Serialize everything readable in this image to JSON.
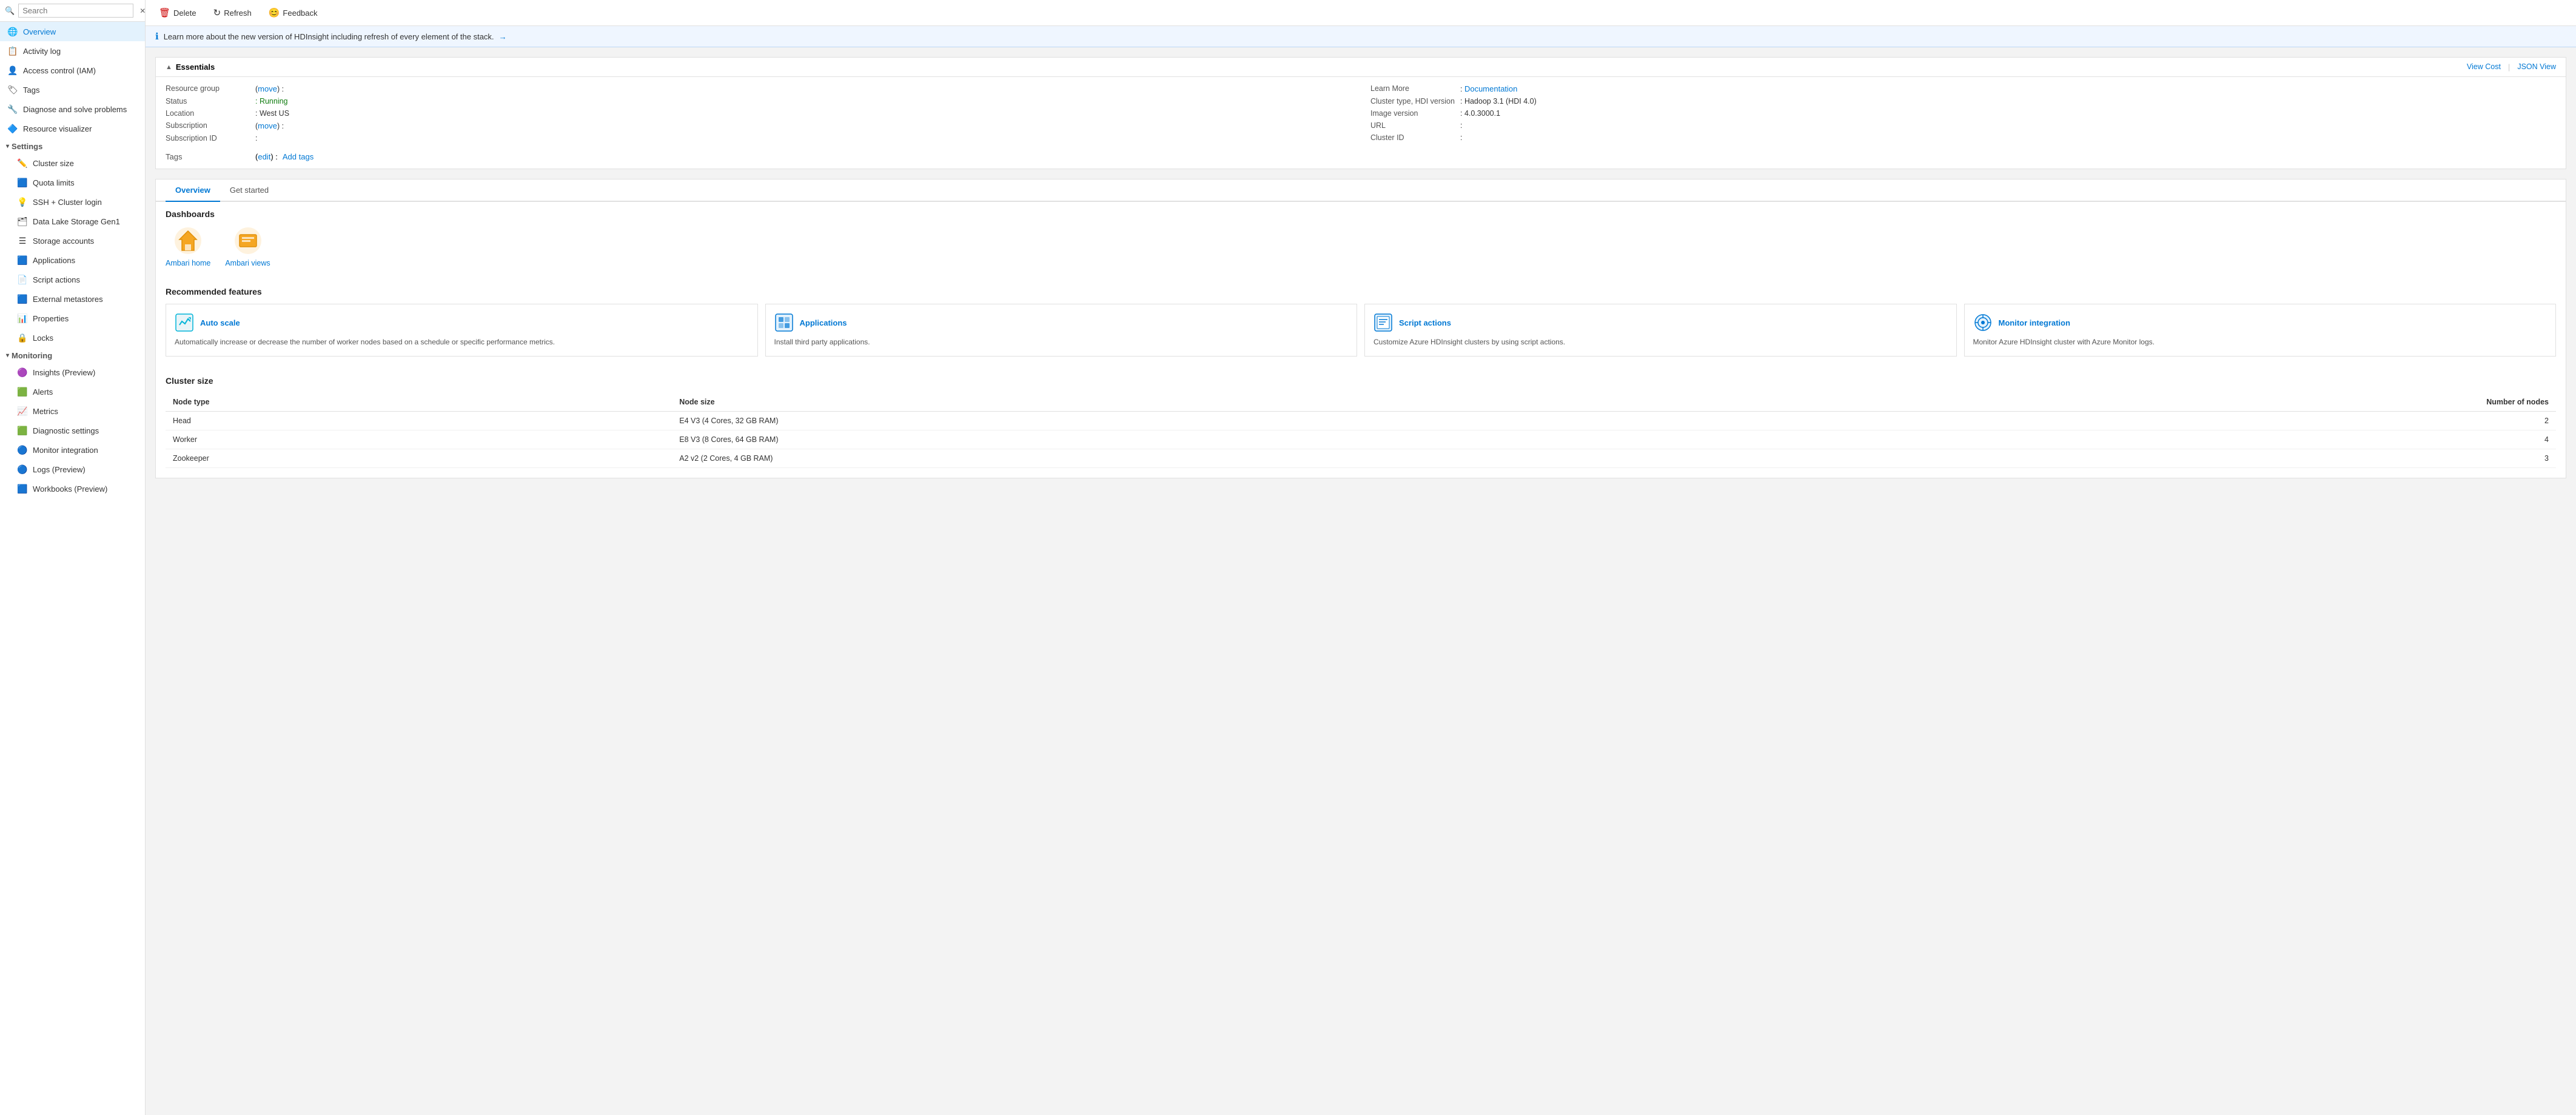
{
  "sidebar": {
    "search_placeholder": "Search",
    "search_value": "",
    "items": [
      {
        "id": "overview",
        "label": "Overview",
        "icon": "🌐",
        "active": true,
        "indent": 0
      },
      {
        "id": "activity-log",
        "label": "Activity log",
        "icon": "📋",
        "active": false,
        "indent": 0
      },
      {
        "id": "access-control",
        "label": "Access control (IAM)",
        "icon": "👤",
        "active": false,
        "indent": 0
      },
      {
        "id": "tags",
        "label": "Tags",
        "icon": "🏷",
        "active": false,
        "indent": 0
      },
      {
        "id": "diagnose",
        "label": "Diagnose and solve problems",
        "icon": "🔧",
        "active": false,
        "indent": 0
      },
      {
        "id": "resource-visualizer",
        "label": "Resource visualizer",
        "icon": "🔷",
        "active": false,
        "indent": 0
      },
      {
        "id": "settings-section",
        "label": "Settings",
        "type": "section"
      },
      {
        "id": "cluster-size",
        "label": "Cluster size",
        "icon": "✏️",
        "active": false,
        "indent": 1
      },
      {
        "id": "quota-limits",
        "label": "Quota limits",
        "icon": "🟦",
        "active": false,
        "indent": 1
      },
      {
        "id": "ssh-cluster-login",
        "label": "SSH + Cluster login",
        "icon": "💡",
        "active": false,
        "indent": 1
      },
      {
        "id": "data-lake-storage",
        "label": "Data Lake Storage Gen1",
        "icon": "🗂",
        "active": false,
        "indent": 1
      },
      {
        "id": "storage-accounts",
        "label": "Storage accounts",
        "icon": "☰",
        "active": false,
        "indent": 1
      },
      {
        "id": "applications",
        "label": "Applications",
        "icon": "🟦",
        "active": false,
        "indent": 1
      },
      {
        "id": "script-actions",
        "label": "Script actions",
        "icon": "📄",
        "active": false,
        "indent": 1
      },
      {
        "id": "external-metastores",
        "label": "External metastores",
        "icon": "🟦",
        "active": false,
        "indent": 1
      },
      {
        "id": "properties",
        "label": "Properties",
        "icon": "📊",
        "active": false,
        "indent": 1
      },
      {
        "id": "locks",
        "label": "Locks",
        "icon": "🔒",
        "active": false,
        "indent": 1
      },
      {
        "id": "monitoring-section",
        "label": "Monitoring",
        "type": "section"
      },
      {
        "id": "insights",
        "label": "Insights (Preview)",
        "icon": "🟣",
        "active": false,
        "indent": 1
      },
      {
        "id": "alerts",
        "label": "Alerts",
        "icon": "🟩",
        "active": false,
        "indent": 1
      },
      {
        "id": "metrics",
        "label": "Metrics",
        "icon": "📈",
        "active": false,
        "indent": 1
      },
      {
        "id": "diagnostic-settings",
        "label": "Diagnostic settings",
        "icon": "🟩",
        "active": false,
        "indent": 1
      },
      {
        "id": "monitor-integration",
        "label": "Monitor integration",
        "icon": "🔵",
        "active": false,
        "indent": 1
      },
      {
        "id": "logs-preview",
        "label": "Logs (Preview)",
        "icon": "🔵",
        "active": false,
        "indent": 1
      },
      {
        "id": "workbooks-preview",
        "label": "Workbooks (Preview)",
        "icon": "🟦",
        "active": false,
        "indent": 1
      }
    ]
  },
  "toolbar": {
    "delete_label": "Delete",
    "refresh_label": "Refresh",
    "feedback_label": "Feedback"
  },
  "info_banner": {
    "text": "Learn more about the new version of HDInsight including refresh of every element of the stack.",
    "link_text": "→"
  },
  "essentials": {
    "title": "Essentials",
    "top_right_links": {
      "view_cost": "View Cost",
      "json_view": "JSON View"
    },
    "left_col": [
      {
        "label": "Resource group",
        "value": "(move)  :",
        "is_link": true,
        "link_text": "move"
      },
      {
        "label": "Status",
        "value": ": Running",
        "is_status": true
      },
      {
        "label": "Location",
        "value": ": West US"
      },
      {
        "label": "Subscription",
        "value": "(move)  :",
        "is_link": true,
        "link_text": "move"
      },
      {
        "label": "Subscription ID",
        "value": ":"
      }
    ],
    "right_col": [
      {
        "label": "Learn More",
        "value": ": Documentation",
        "is_link": true,
        "link_text": "Documentation"
      },
      {
        "label": "Cluster type, HDI version",
        "value": ": Hadoop 3.1 (HDI 4.0)"
      },
      {
        "label": "Image version",
        "value": ": 4.0.3000.1"
      },
      {
        "label": "URL",
        "value": ":"
      },
      {
        "label": "Cluster ID",
        "value": ":"
      }
    ],
    "tags_label": "Tags",
    "tags_edit_text": "edit",
    "tags_add_text": "Add tags"
  },
  "tabs": [
    {
      "id": "overview-tab",
      "label": "Overview",
      "active": true
    },
    {
      "id": "get-started-tab",
      "label": "Get started",
      "active": false
    }
  ],
  "dashboards": {
    "heading": "Dashboards",
    "items": [
      {
        "id": "ambari-home",
        "label": "Ambari home"
      },
      {
        "id": "ambari-views",
        "label": "Ambari views"
      }
    ]
  },
  "recommended_features": {
    "heading": "Recommended features",
    "items": [
      {
        "id": "auto-scale",
        "title": "Auto scale",
        "desc": "Automatically increase or decrease the number of worker nodes based on a schedule or specific performance metrics.",
        "color": "#00b4d8"
      },
      {
        "id": "applications",
        "title": "Applications",
        "desc": "Install third party applications.",
        "color": "#0078d4"
      },
      {
        "id": "script-actions",
        "title": "Script actions",
        "desc": "Customize Azure HDInsight clusters by using script actions.",
        "color": "#0078d4"
      },
      {
        "id": "monitor-integration",
        "title": "Monitor integration",
        "desc": "Monitor Azure HDInsight cluster with Azure Monitor logs.",
        "color": "#0078d4"
      }
    ]
  },
  "cluster_size": {
    "heading": "Cluster size",
    "columns": [
      "Node type",
      "Node size",
      "Number of nodes"
    ],
    "rows": [
      {
        "node_type": "Head",
        "node_size": "E4 V3 (4 Cores, 32 GB RAM)",
        "num_nodes": "2"
      },
      {
        "node_type": "Worker",
        "node_size": "E8 V3 (8 Cores, 64 GB RAM)",
        "num_nodes": "4"
      },
      {
        "node_type": "Zookeeper",
        "node_size": "A2 v2 (2 Cores, 4 GB RAM)",
        "num_nodes": "3"
      }
    ]
  }
}
